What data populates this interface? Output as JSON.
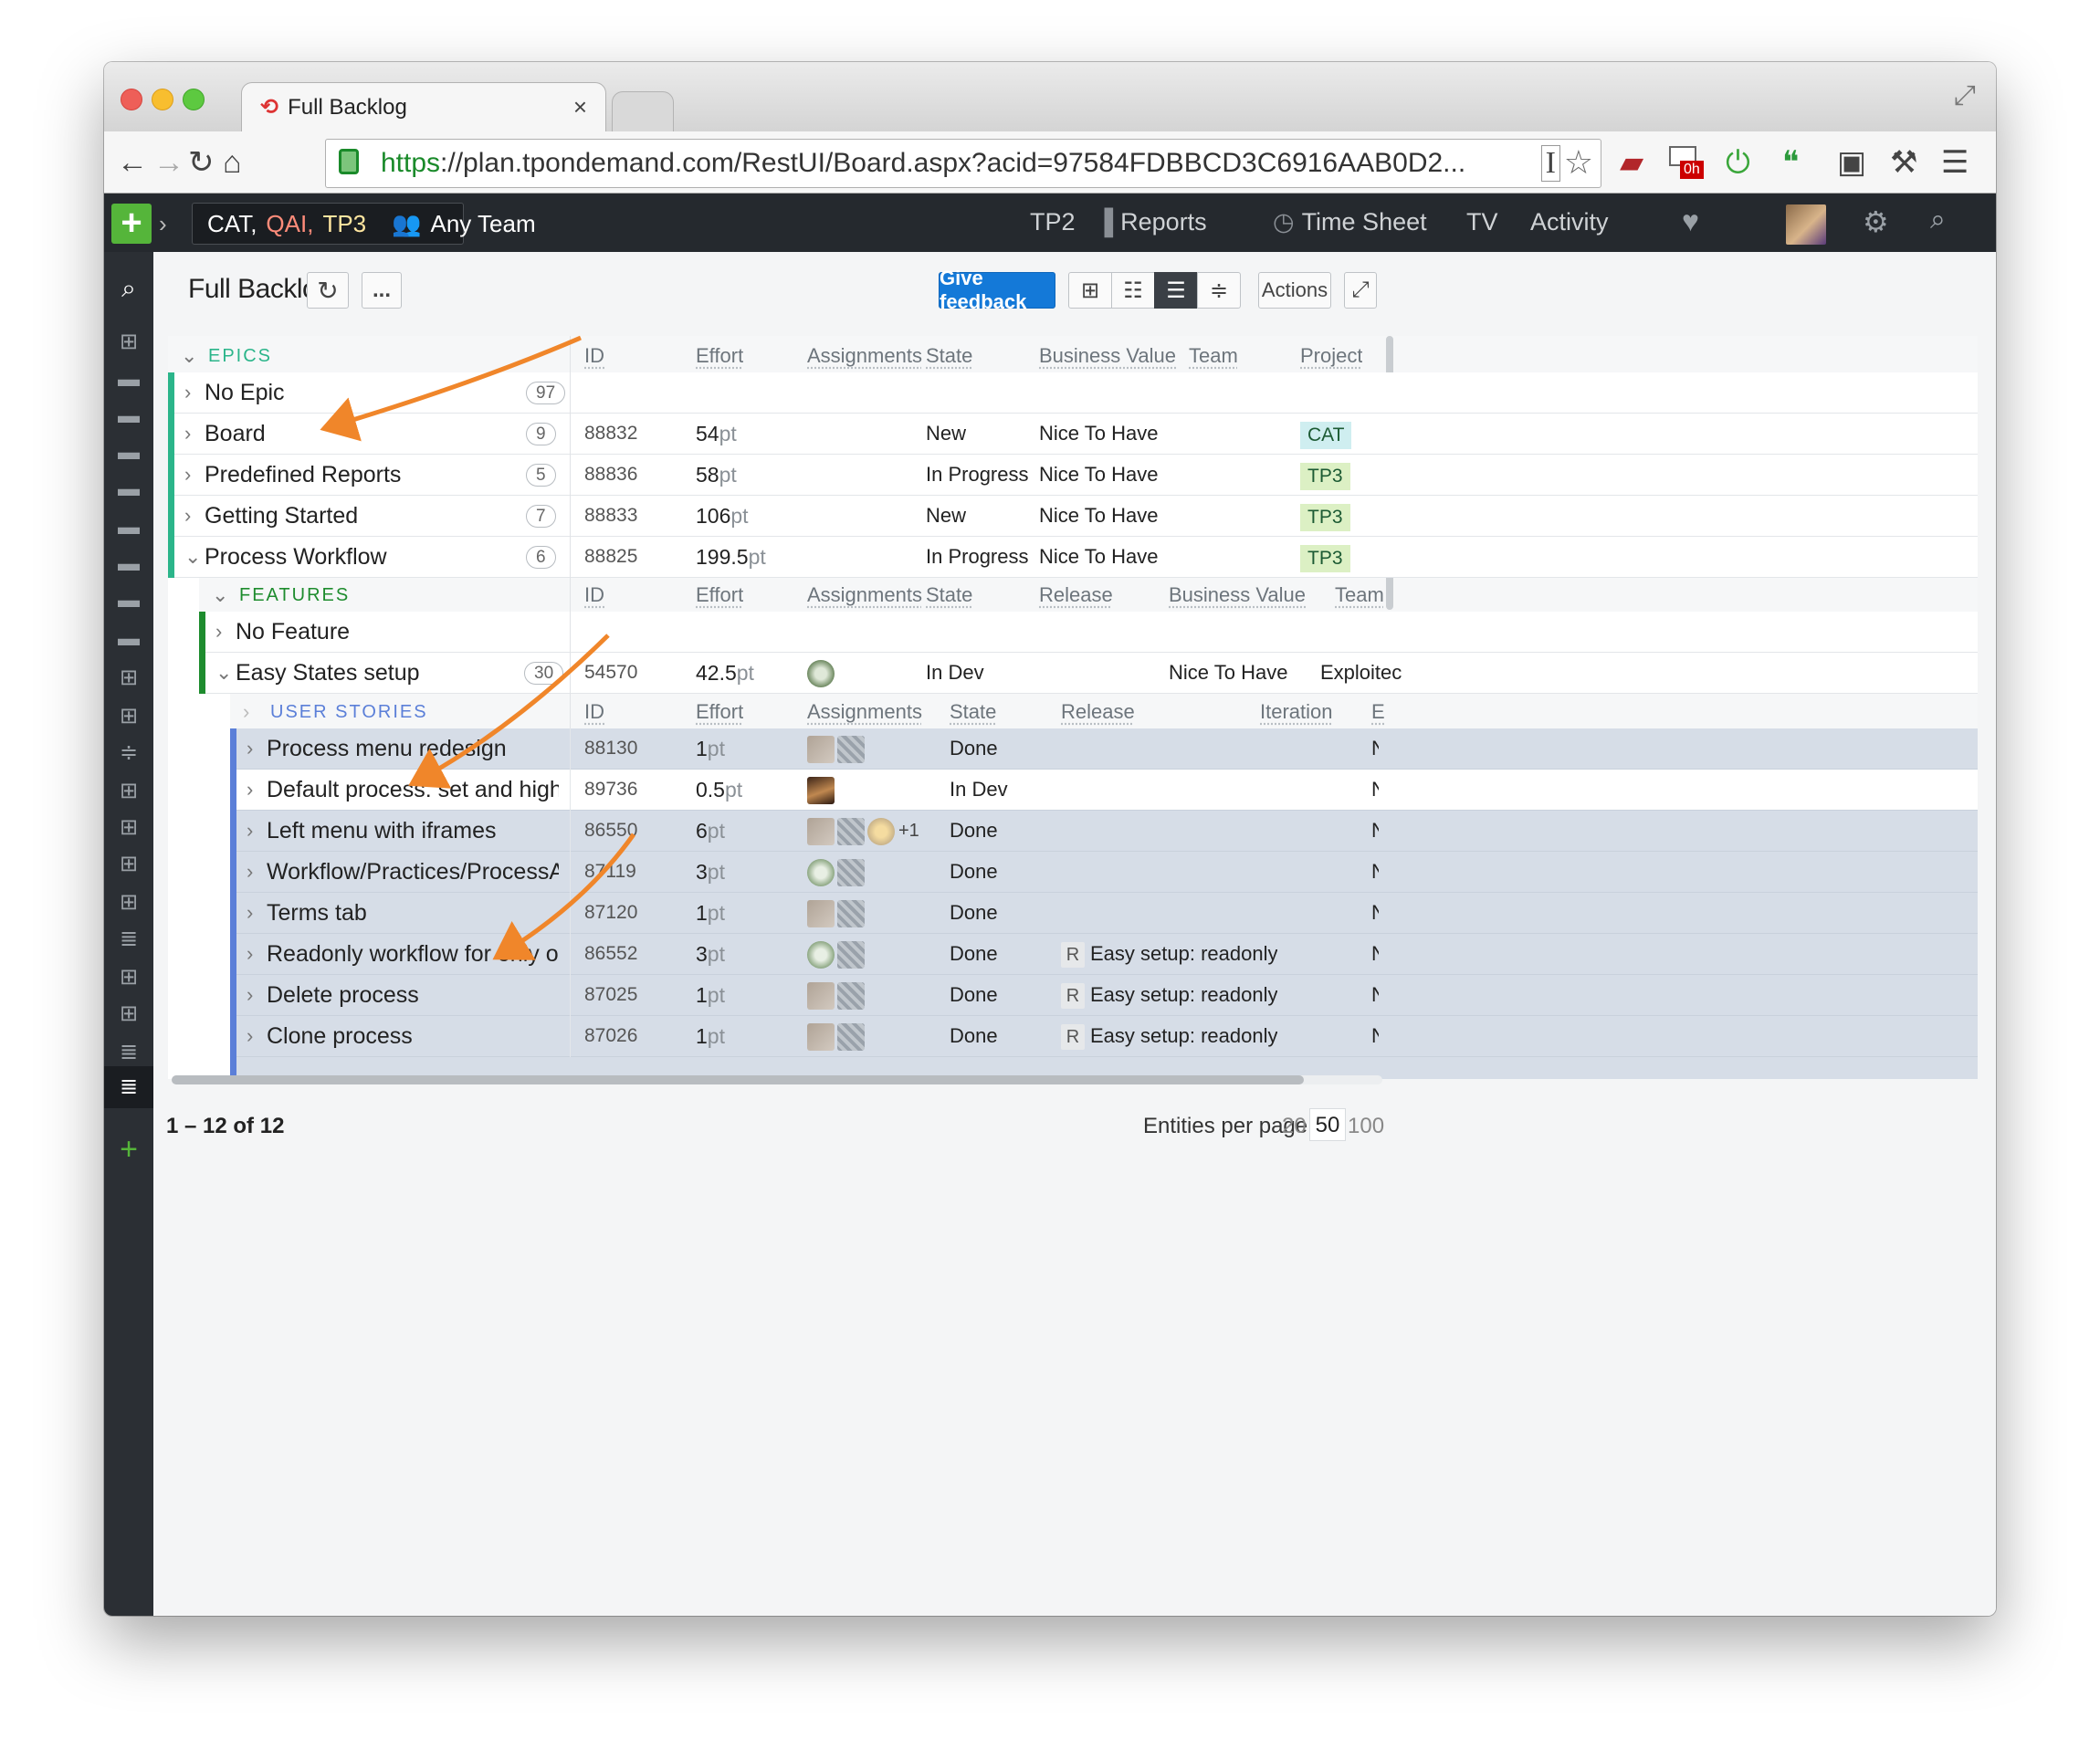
{
  "browser": {
    "tab_title": "Full Backlog",
    "tab_close": "×",
    "url_scheme": "https",
    "url_rest": "://plan.tpondemand.com/RestUI/Board.aspx?acid=97584FDBBCD3C6916AAB0D2...",
    "timer_badge": "0h"
  },
  "topnav": {
    "projects": [
      "CAT,",
      "QAI,",
      "TP3"
    ],
    "team": "Any Team",
    "items": [
      "TP2",
      "Reports",
      "Time Sheet",
      "TV",
      "Activity"
    ]
  },
  "page": {
    "title": "Full Backlog",
    "more": "...",
    "feedback": "Give feedback",
    "actions": "Actions"
  },
  "epics": {
    "group": "EPICS",
    "columns": [
      "ID",
      "Effort",
      "Assignments",
      "State",
      "Business Value",
      "Team",
      "Project"
    ],
    "rows": [
      {
        "name": "No Epic",
        "count": "97",
        "id": "",
        "effort": "",
        "unit": "",
        "state": "",
        "bv": "",
        "project": ""
      },
      {
        "name": "Board",
        "count": "9",
        "id": "88832",
        "effort": "54",
        "unit": "pt",
        "state": "New",
        "bv": "Nice To Have",
        "project": "CAT"
      },
      {
        "name": "Predefined Reports",
        "count": "5",
        "id": "88836",
        "effort": "58",
        "unit": "pt",
        "state": "In Progress",
        "bv": "Nice To Have",
        "project": "TP3"
      },
      {
        "name": "Getting Started",
        "count": "7",
        "id": "88833",
        "effort": "106",
        "unit": "pt",
        "state": "New",
        "bv": "Nice To Have",
        "project": "TP3"
      },
      {
        "name": "Process Workflow",
        "count": "6",
        "id": "88825",
        "effort": "199.5",
        "unit": "pt",
        "state": "In Progress",
        "bv": "Nice To Have",
        "project": "TP3"
      }
    ]
  },
  "features": {
    "group": "FEATURES",
    "columns": [
      "ID",
      "Effort",
      "Assignments",
      "State",
      "Release",
      "Business Value",
      "Team"
    ],
    "rows": [
      {
        "name": "No Feature",
        "count": "",
        "id": "",
        "effort": "",
        "unit": "",
        "state": "",
        "bv": "",
        "team": ""
      },
      {
        "name": "Easy States setup",
        "count": "30",
        "id": "54570",
        "effort": "42.5",
        "unit": "pt",
        "state": "In Dev",
        "bv": "Nice To Have",
        "team": "Exploitec"
      }
    ]
  },
  "stories": {
    "group": "USER STORIES",
    "columns": [
      "ID",
      "Effort",
      "Assignments",
      "State",
      "Release",
      "Iteration",
      "E"
    ],
    "rows": [
      {
        "name": "Process menu redesign",
        "id": "88130",
        "effort": "1",
        "unit": "pt",
        "state": "Done",
        "release_badge": "",
        "release": "",
        "extra": "",
        "tail": "N"
      },
      {
        "name": "Default process: set and highli...",
        "id": "89736",
        "effort": "0.5",
        "unit": "pt",
        "state": "In Dev",
        "release_badge": "",
        "release": "",
        "extra": "",
        "tail": "N"
      },
      {
        "name": "Left menu with iframes",
        "id": "86550",
        "effort": "6",
        "unit": "pt",
        "state": "Done",
        "release_badge": "",
        "release": "",
        "extra": "+1",
        "tail": "N"
      },
      {
        "name": "Workflow/Practices/ProcessA...",
        "id": "87119",
        "effort": "3",
        "unit": "pt",
        "state": "Done",
        "release_badge": "",
        "release": "",
        "extra": "",
        "tail": "N"
      },
      {
        "name": "Terms tab",
        "id": "87120",
        "effort": "1",
        "unit": "pt",
        "state": "Done",
        "release_badge": "",
        "release": "",
        "extra": "",
        "tail": "N"
      },
      {
        "name": "Readonly workflow for only o...",
        "id": "86552",
        "effort": "3",
        "unit": "pt",
        "state": "Done",
        "release_badge": "R",
        "release": "Easy setup: readonly",
        "extra": "",
        "tail": "N"
      },
      {
        "name": "Delete process",
        "id": "87025",
        "effort": "1",
        "unit": "pt",
        "state": "Done",
        "release_badge": "R",
        "release": "Easy setup: readonly",
        "extra": "",
        "tail": "N"
      },
      {
        "name": "Clone process",
        "id": "87026",
        "effort": "1",
        "unit": "pt",
        "state": "Done",
        "release_badge": "R",
        "release": "Easy setup: readonly",
        "extra": "",
        "tail": "N"
      }
    ]
  },
  "footer": {
    "range": "1 – 12 of 12",
    "per_page_label": "Entities per page",
    "per_page_options": [
      "20",
      "50",
      "100"
    ],
    "per_page_selected": "50"
  },
  "colors": {
    "epic_bar": "#2bb58a",
    "feature_bar": "#1e8c2e",
    "story_bar": "#5b7fd8",
    "feedback": "#1479d8",
    "annotation_arrow": "#f0862a"
  }
}
